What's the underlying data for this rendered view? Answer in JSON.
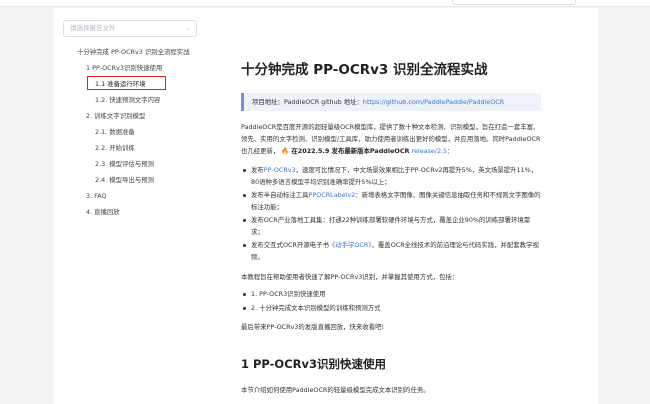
{
  "file_select": {
    "placeholder": "请选择报告文件",
    "chevron_icon": "chevron-down-icon"
  },
  "toc": [
    {
      "label": "十分钟完成 PP-OCRv3 识别全流程实战",
      "level": 0
    },
    {
      "label": "1 PP-OCRv3识别快速使用",
      "level": 1
    },
    {
      "label": "1.1 准备运行环境",
      "level": 2,
      "highlighted": true
    },
    {
      "label": "1.2. 快速预测文字内容",
      "level": 2
    },
    {
      "label": "2. 训练文字识别模型",
      "level": 1
    },
    {
      "label": "2.1. 数据准备",
      "level": 2
    },
    {
      "label": "2.2. 开始训练",
      "level": 2
    },
    {
      "label": "2.3. 模型评估与预测",
      "level": 2
    },
    {
      "label": "2.4. 模型导出与预测",
      "level": 2
    },
    {
      "label": "3. FAQ",
      "level": 1
    },
    {
      "label": "4. 直播回放",
      "level": 1
    }
  ],
  "article": {
    "title": "十分钟完成 PP-OCRv3 识别全流程实战",
    "callout_prefix": "项目地址：PaddleOCR github 地址：",
    "callout_link": "https://github.com/PaddlePaddle/PaddleOCR",
    "intro_1": "PaddleOCR是百度开源的超轻量级OCR模型库，提供了数十种文本检测、识别模型，旨在打造一套丰富、领先、实用的文字检测、识别模型/工具库，助力使用者训练出更好的模型，并应用落地。同时PaddleOCR也几经更新，",
    "intro_fire": "🔥",
    "intro_strong": "在2022.5.9 发布最新版本PaddleOCR",
    "intro_release": "release/2.5",
    "intro_end": "：",
    "bullets": [
      {
        "pre": "发布",
        "link": "PP-OCRv3",
        "post": "，速度可比情况下，中文场景效果相比于PP-OCRv2再提升5%，英文场景提升11%，80语种多语言模型平均识别准确率提升5%以上；"
      },
      {
        "pre": "发布半自动标注工具",
        "link": "PPOCRLabelv2",
        "post": "：新增表格文字图像、图像关键信息抽取任务和不规则文字图像的标注功能；"
      },
      {
        "pre": "发布OCR产业落地工具集：打通22种训练部署软硬件环境与方式，覆盖企业90%的训练部署环境需求；",
        "link": "",
        "post": ""
      },
      {
        "pre": "发布交互式OCR开源电子书",
        "link": "《动手学OCR》",
        "post": "，覆盖OCR全线技术的前沿理论与代码实践，并配套教学视频。"
      }
    ],
    "tutorial_intro": "本教程旨在帮助使用者快速了解PP-OCRv3识别，并掌握其使用方式，包括：",
    "tutorial_items": [
      "1. PP-OCR3识别快速使用",
      "2. 十分钟完成文本识别模型的训练和预测方式"
    ],
    "closing": "最后带来PP-OCRv3的发版直播回放，快来收看吧!",
    "section_title": "1 PP-OCRv3识别快速使用",
    "section_text": "本节介绍如何使用PaddleOCR的轻量级模型完成文本识别的任务。"
  }
}
